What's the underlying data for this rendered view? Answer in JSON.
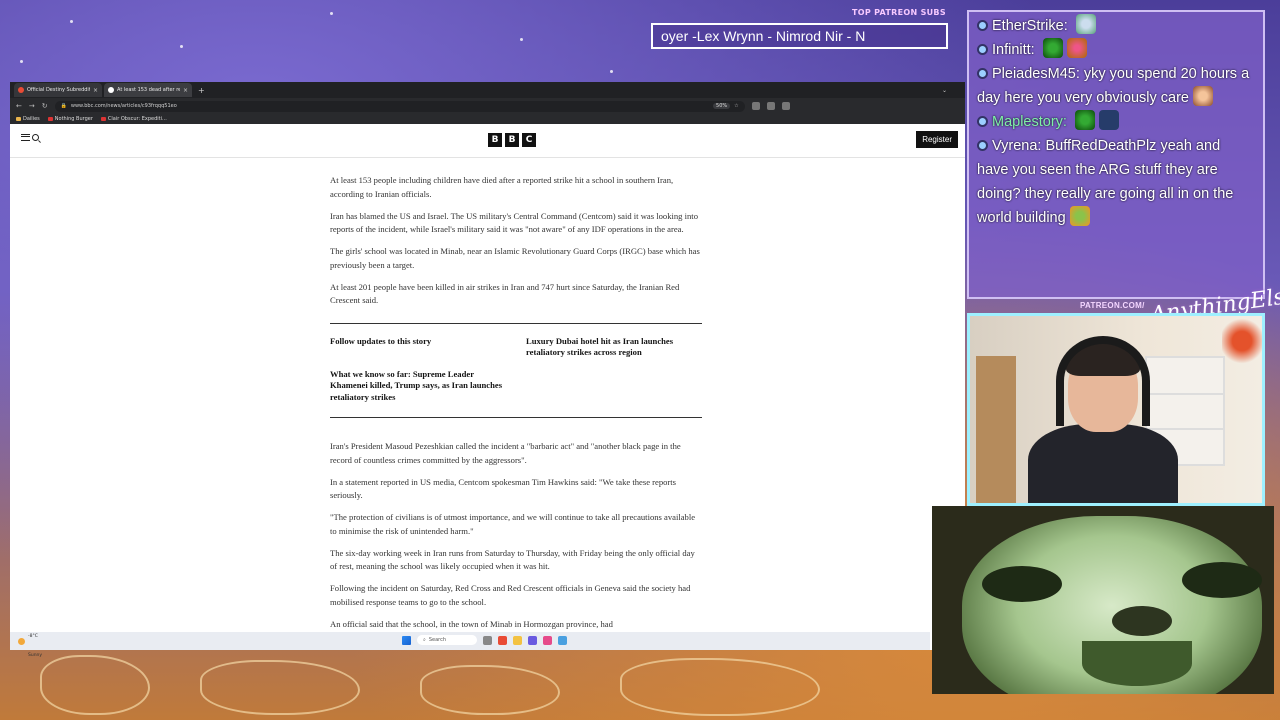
{
  "browser": {
    "tabs": [
      {
        "title": "Official Destiny Subreddit",
        "active": false
      },
      {
        "title": "At least 153 dead after reporte...",
        "active": true
      }
    ],
    "url": "www.bbc.com/news/articles/c93frqqq51eo",
    "zoom": "50%",
    "bookmarks": [
      "Dailies",
      "Nothing Burger",
      "Clair Obscur: Expediti..."
    ]
  },
  "bbc": {
    "logo": [
      "B",
      "B",
      "C"
    ],
    "register_label": "Register"
  },
  "article": {
    "paragraphs_top": [
      "At least 153 people including children have died after a reported strike hit a school in southern Iran, according to Iranian officials.",
      "Iran has blamed the US and Israel. The US military's Central Command (Centcom) said it was looking into reports of the incident, while Israel's military said it was \"not aware\" of any IDF operations in the area.",
      "The girls' school was located in Minab, near an Islamic Revolutionary Guard Corps (IRGC) base which has previously been a target.",
      "At least 201 people have been killed in air strikes in Iran and 747 hurt since Saturday, the Iranian Red Crescent said."
    ],
    "related": [
      "Follow updates to this story",
      "Luxury Dubai hotel hit as Iran launches retaliatory strikes across region",
      "What we know so far: Supreme Leader Khamenei killed, Trump says, as Iran launches retaliatory strikes"
    ],
    "paragraphs_bottom": [
      "Iran's President Masoud Pezeshkian called the incident a \"barbaric act\" and \"another black page in the record of countless crimes committed by the aggressors\".",
      "In a statement reported in US media, Centcom spokesman Tim Hawkins said: \"We take these reports seriously.",
      "\"The protection of civilians is of utmost importance, and we will continue to take all precautions available to minimise the risk of unintended harm.\"",
      "The six-day working week in Iran runs from Saturday to Thursday, with Friday being the only official day of rest, meaning the school was likely occupied when it was hit.",
      "Following the incident on Saturday, Red Cross and Red Crescent officials in Geneva said the society had mobilised response teams to go to the school.",
      "An official said that the school, in the town of Minab in Hormozgan province, had"
    ]
  },
  "taskbar": {
    "weather_temp": "-8°C",
    "weather_desc": "Sunny",
    "search_label": "Search"
  },
  "overlay": {
    "subs_label": "TOP PATREON SUBS",
    "subs_ticker": "oyer -Lex Wrynn - Nimrod Nir - N",
    "patreon_label": "PATREON.COM/",
    "brand_script": "AnythingElse"
  },
  "chat": [
    {
      "user": "EtherStrike:",
      "text": "",
      "emotes": [
        "em-a"
      ]
    },
    {
      "user": "Infinitt:",
      "text": "",
      "emotes": [
        "em-c",
        "em-b"
      ]
    },
    {
      "user": "PleiadesM45:",
      "text": "yky you spend 20 hours a day here you very obviously care",
      "emotes": [
        "em-d"
      ]
    },
    {
      "user": "Maplestory:",
      "text": "",
      "emotes": [
        "em-c",
        "em-e"
      ]
    },
    {
      "user": "Vyrena:",
      "text": "BuffRedDeathPlz yeah and have you seen the ARG stuff they are doing? they really are going all in on the world building",
      "emotes": [
        "em-f"
      ]
    }
  ],
  "colors": {
    "chat_bg": "#8060c8",
    "bbc_black": "#111111",
    "webcam_border": "#9ef0ff"
  }
}
